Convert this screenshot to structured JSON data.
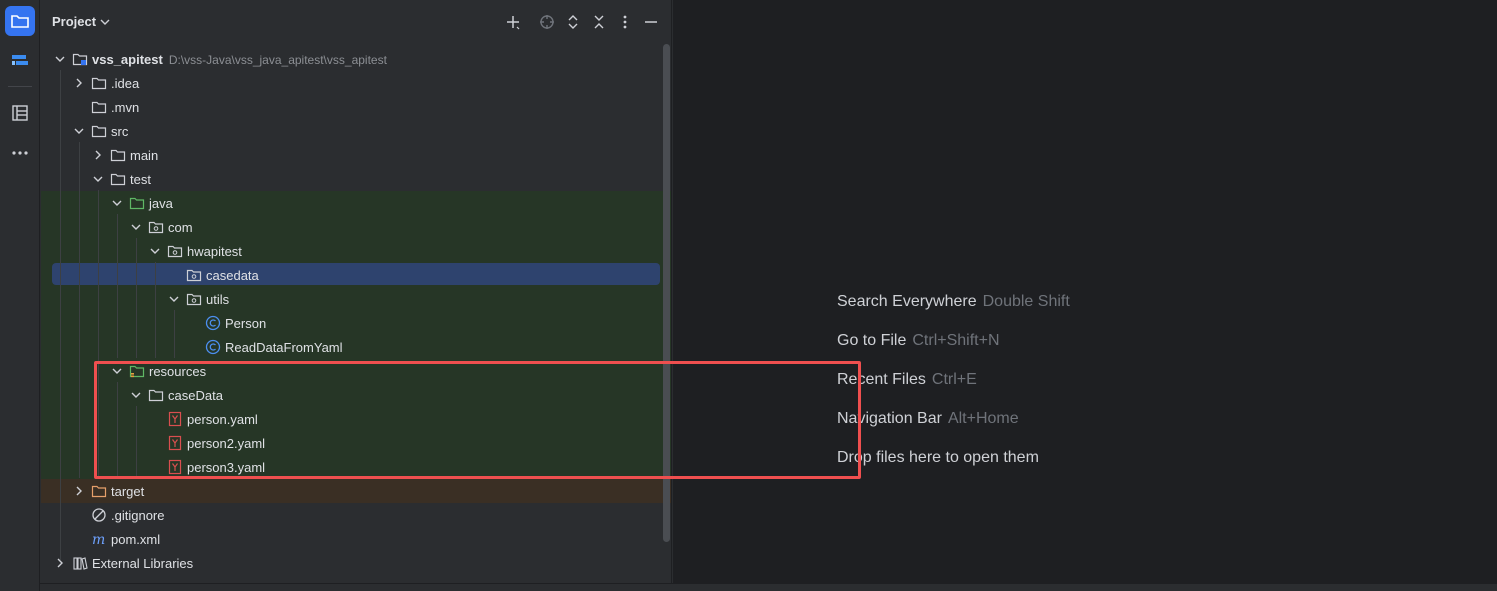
{
  "panel": {
    "title": "Project",
    "title_chevron": "chevron-down-icon"
  },
  "tree": [
    {
      "label": "vss_apitest",
      "path": "D:\\vss-Java\\vss_java_apitest\\vss_apitest",
      "icon": "module-folder-icon",
      "expanded": true
    },
    {
      "label": ".idea",
      "icon": "folder-icon",
      "expanded": false
    },
    {
      "label": ".mvn",
      "icon": "folder-icon"
    },
    {
      "label": "src",
      "icon": "folder-icon",
      "expanded": true
    },
    {
      "label": "main",
      "icon": "folder-icon",
      "expanded": false
    },
    {
      "label": "test",
      "icon": "folder-icon",
      "expanded": true
    },
    {
      "label": "java",
      "icon": "test-source-folder-icon",
      "expanded": true
    },
    {
      "label": "com",
      "icon": "package-icon",
      "expanded": true
    },
    {
      "label": "hwapitest",
      "icon": "package-icon",
      "expanded": true
    },
    {
      "label": "casedata",
      "icon": "package-icon",
      "selected": true
    },
    {
      "label": "utils",
      "icon": "package-icon",
      "expanded": true
    },
    {
      "label": "Person",
      "icon": "class-icon"
    },
    {
      "label": "ReadDataFromYaml",
      "icon": "class-icon"
    },
    {
      "label": "resources",
      "icon": "test-resources-folder-icon",
      "expanded": true
    },
    {
      "label": "caseData",
      "icon": "folder-icon",
      "expanded": true
    },
    {
      "label": "person.yaml",
      "icon": "yaml-file-icon"
    },
    {
      "label": "person2.yaml",
      "icon": "yaml-file-icon"
    },
    {
      "label": "person3.yaml",
      "icon": "yaml-file-icon"
    },
    {
      "label": "target",
      "icon": "excluded-folder-icon",
      "expanded": false
    },
    {
      "label": ".gitignore",
      "icon": "ignore-file-icon"
    },
    {
      "label": "pom.xml",
      "icon": "maven-file-icon"
    },
    {
      "label": "External Libraries",
      "icon": "library-icon",
      "expanded": false
    }
  ],
  "editor_hints": [
    {
      "action": "Search Everywhere",
      "shortcut": "Double Shift"
    },
    {
      "action": "Go to File",
      "shortcut": "Ctrl+Shift+N"
    },
    {
      "action": "Recent Files",
      "shortcut": "Ctrl+E"
    },
    {
      "action": "Navigation Bar",
      "shortcut": "Alt+Home"
    },
    {
      "action": "Drop files here to open them",
      "shortcut": ""
    }
  ],
  "colors": {
    "accent": "#3574f0",
    "selection": "#2e436e",
    "test_band": "#263626",
    "excluded_band": "#3a2f24",
    "annotation_box": "#ef4f4f"
  }
}
